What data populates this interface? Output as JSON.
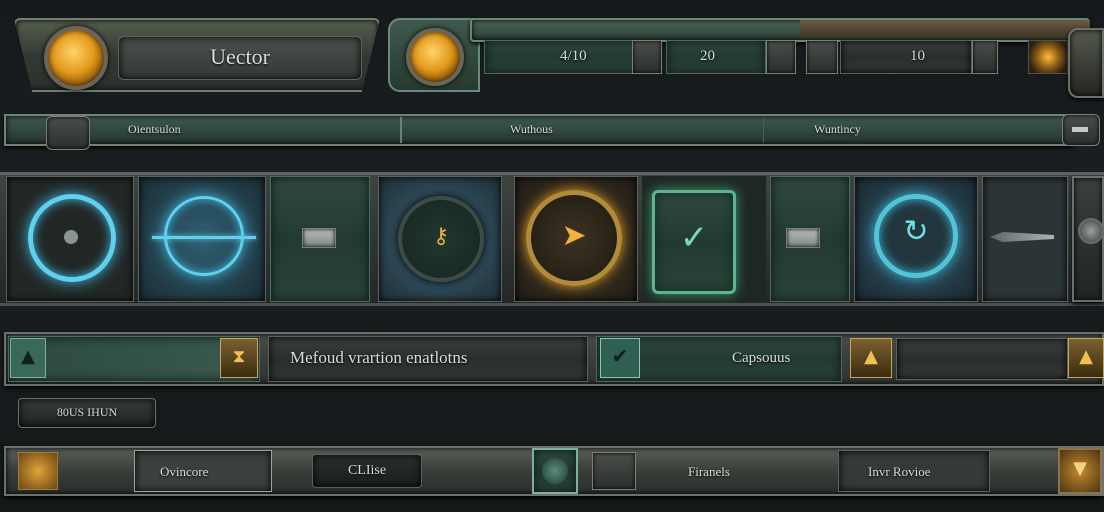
{
  "top_bar": {
    "title": "Uector",
    "counters": [
      "4/10",
      "20",
      "10"
    ]
  },
  "tab_bar": {
    "tabs": [
      "Oientsulon",
      "Wuthous",
      "Wuntincy"
    ]
  },
  "icons_row": {
    "slots": [
      "target-icon",
      "crosshair-icon",
      "menu-icon",
      "key-icon",
      "compass-icon",
      "checkmark-icon",
      "menu-icon",
      "refresh-icon",
      "blade-icon"
    ]
  },
  "info_bar": {
    "message": "Mefoud vrartion enatlotns",
    "right_label": "Capsouus"
  },
  "status_button": "80US IHUN",
  "bottom_bar": {
    "left_label": "Ovincore",
    "button_label": "CLIise",
    "mid_label": "Firanels",
    "right_label": "Invr Rovioe"
  },
  "colors": {
    "accent_green": "#2f4a41",
    "accent_gold": "#e29a1b",
    "accent_blue": "#5fd0ee"
  }
}
